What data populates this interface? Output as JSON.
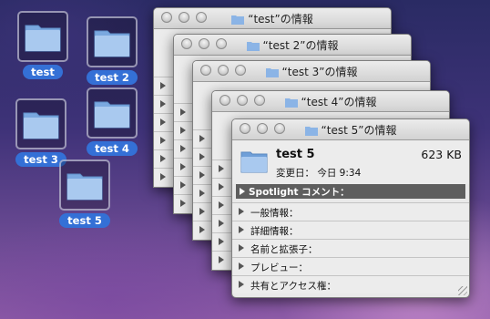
{
  "desktop": {
    "icons": [
      {
        "label": "test"
      },
      {
        "label": "test 2"
      },
      {
        "label": "test 3"
      },
      {
        "label": "test 4"
      },
      {
        "label": "test 5"
      }
    ]
  },
  "windows": [
    {
      "title": "“test”の情報"
    },
    {
      "title": "“test 2”の情報"
    },
    {
      "title": "“test 3”の情報"
    },
    {
      "title": "“test 4”の情報"
    },
    {
      "title": "“test 5”の情報",
      "name": "test 5",
      "size": "623 KB",
      "modified": "変更日：  今日 9:34",
      "spotlight": "Spotlight コメント：",
      "sections": [
        "一般情報：",
        "詳細情報：",
        "名前と拡張子：",
        "プレビュー：",
        "共有とアクセス権："
      ]
    }
  ],
  "icons": {
    "folder": "folder-icon",
    "close": "close-icon",
    "minimize": "minimize-icon",
    "zoom": "zoom-icon",
    "disclosure": "disclosure-triangle-icon"
  },
  "colors": {
    "selection_label": "#3470d6",
    "spotlight_bar": "#5e5e5e",
    "folder_blue": "#8bb4e6"
  }
}
